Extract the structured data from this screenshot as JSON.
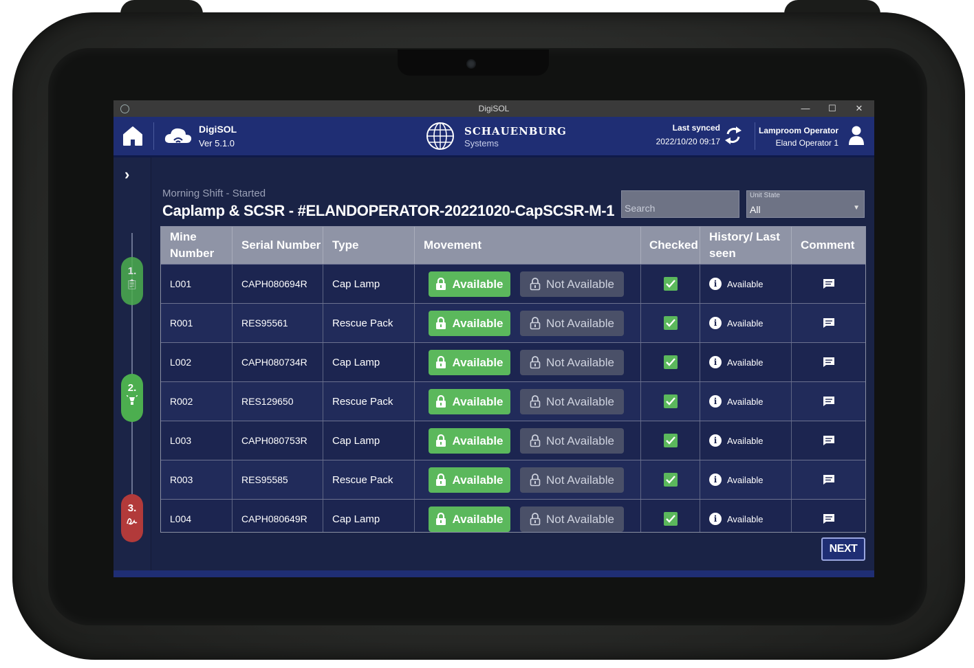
{
  "window": {
    "title": "DigiSOL",
    "minimize": "—",
    "maximize": "☐",
    "close": "✕"
  },
  "header": {
    "app_name": "DigiSOL",
    "version": "Ver 5.1.0",
    "brand": "SCHAUENBURG",
    "brand_sub": "Systems",
    "last_synced_label": "Last synced",
    "last_synced_time": "2022/10/20 09:17",
    "role": "Lamproom Operator",
    "operator": "Eland Operator 1"
  },
  "stepper": {
    "steps": [
      {
        "num": "1.",
        "icon": "clipboard-icon"
      },
      {
        "num": "2.",
        "icon": "lamp-icon"
      },
      {
        "num": "3.",
        "icon": "signature-icon"
      }
    ]
  },
  "main": {
    "subtitle": "Morning Shift - Started",
    "title": "Caplamp & SCSR - #ELANDOPERATOR-20221020-CapSCSR-M-1",
    "search_placeholder": "Search",
    "unit_state_label": "Unit State",
    "unit_state_value": "All",
    "next_label": "NEXT"
  },
  "table": {
    "headers": {
      "mine_number": "Mine Number",
      "serial_number": "Serial Number",
      "type": "Type",
      "movement": "Movement",
      "checked": "Checked",
      "history": "History/ Last seen",
      "comment": "Comment"
    },
    "available_label": "Available",
    "not_available_label": "Not Available",
    "history_label": "Available",
    "rows": [
      {
        "mine": "L001",
        "serial": "CAPH080694R",
        "type": "Cap Lamp"
      },
      {
        "mine": "R001",
        "serial": "RES95561",
        "type": "Rescue Pack"
      },
      {
        "mine": "L002",
        "serial": "CAPH080734R",
        "type": "Cap Lamp"
      },
      {
        "mine": "R002",
        "serial": "RES129650",
        "type": "Rescue Pack"
      },
      {
        "mine": "L003",
        "serial": "CAPH080753R",
        "type": "Cap Lamp"
      },
      {
        "mine": "R003",
        "serial": "RES95585",
        "type": "Rescue Pack"
      },
      {
        "mine": "L004",
        "serial": "CAPH080649R",
        "type": "Cap Lamp"
      }
    ]
  },
  "colors": {
    "header": "#1f2e74",
    "available": "#5bb85c",
    "not_available": "#4a5068",
    "step3": "#b23a3a"
  }
}
